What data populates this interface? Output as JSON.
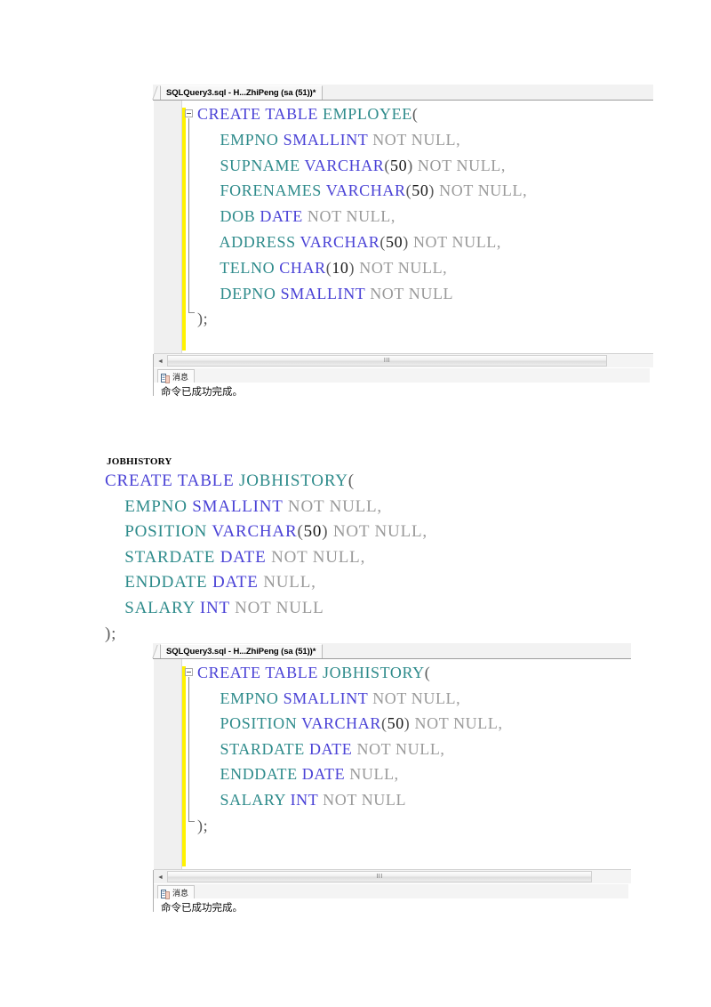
{
  "document": {
    "jobhistory_heading": "JOBHISTORY",
    "jobhistory_code_lines": [
      [
        {
          "t": "CREATE TABLE ",
          "c": "kw"
        },
        {
          "t": "JOBHISTORY",
          "c": "ident"
        },
        {
          "t": "(",
          "c": "punc"
        }
      ],
      [
        {
          "t": "    ",
          "c": "punc"
        },
        {
          "t": "EMPNO ",
          "c": "ident"
        },
        {
          "t": "SMALLINT ",
          "c": "kw"
        },
        {
          "t": "NOT NULL,",
          "c": "gray"
        }
      ],
      [
        {
          "t": "    ",
          "c": "punc"
        },
        {
          "t": "POSITION ",
          "c": "ident"
        },
        {
          "t": "VARCHAR",
          "c": "kw"
        },
        {
          "t": "(",
          "c": "punc"
        },
        {
          "t": "50",
          "c": "num"
        },
        {
          "t": ") ",
          "c": "punc"
        },
        {
          "t": "NOT NULL,",
          "c": "gray"
        }
      ],
      [
        {
          "t": "    ",
          "c": "punc"
        },
        {
          "t": "STARDATE ",
          "c": "ident"
        },
        {
          "t": "DATE ",
          "c": "kw"
        },
        {
          "t": "NOT NULL,",
          "c": "gray"
        }
      ],
      [
        {
          "t": "    ",
          "c": "punc"
        },
        {
          "t": "ENDDATE ",
          "c": "ident"
        },
        {
          "t": "DATE ",
          "c": "kw"
        },
        {
          "t": "NULL,",
          "c": "gray"
        }
      ],
      [
        {
          "t": "    ",
          "c": "punc"
        },
        {
          "t": "SALARY ",
          "c": "ident"
        },
        {
          "t": "INT ",
          "c": "kw"
        },
        {
          "t": "NOT NULL",
          "c": "gray"
        }
      ],
      [
        {
          "t": ");",
          "c": "punc"
        }
      ]
    ]
  },
  "screenshots": [
    {
      "tab_title": "SQLQuery3.sql - H...ZhiPeng (sa (51))*",
      "code_lines": [
        [
          {
            "t": "CREATE TABLE ",
            "c": "kw"
          },
          {
            "t": "EMPLOYEE",
            "c": "ident"
          },
          {
            "t": "(",
            "c": "punc"
          }
        ],
        [
          {
            "t": "     ",
            "c": "punc"
          },
          {
            "t": "EMPNO ",
            "c": "ident"
          },
          {
            "t": "SMALLINT ",
            "c": "kw"
          },
          {
            "t": "NOT NULL,",
            "c": "gray"
          }
        ],
        [
          {
            "t": "     ",
            "c": "punc"
          },
          {
            "t": "SUPNAME ",
            "c": "ident"
          },
          {
            "t": "VARCHAR",
            "c": "kw"
          },
          {
            "t": "(",
            "c": "punc"
          },
          {
            "t": "50",
            "c": "num"
          },
          {
            "t": ") ",
            "c": "punc"
          },
          {
            "t": "NOT NULL,",
            "c": "gray"
          }
        ],
        [
          {
            "t": "     ",
            "c": "punc"
          },
          {
            "t": "FORENAMES ",
            "c": "ident"
          },
          {
            "t": "VARCHAR",
            "c": "kw"
          },
          {
            "t": "(",
            "c": "punc"
          },
          {
            "t": "50",
            "c": "num"
          },
          {
            "t": ") ",
            "c": "punc"
          },
          {
            "t": "NOT NULL,",
            "c": "gray"
          }
        ],
        [
          {
            "t": "     ",
            "c": "punc"
          },
          {
            "t": "DOB ",
            "c": "ident"
          },
          {
            "t": "DATE ",
            "c": "kw"
          },
          {
            "t": "NOT NULL,",
            "c": "gray"
          }
        ],
        [
          {
            "t": "     ",
            "c": "punc"
          },
          {
            "t": "ADDRESS ",
            "c": "ident"
          },
          {
            "t": "VARCHAR",
            "c": "kw"
          },
          {
            "t": "(",
            "c": "punc"
          },
          {
            "t": "50",
            "c": "num"
          },
          {
            "t": ") ",
            "c": "punc"
          },
          {
            "t": "NOT NULL,",
            "c": "gray"
          }
        ],
        [
          {
            "t": "     ",
            "c": "punc"
          },
          {
            "t": "TELNO ",
            "c": "ident"
          },
          {
            "t": "CHAR",
            "c": "kw"
          },
          {
            "t": "(",
            "c": "punc"
          },
          {
            "t": "10",
            "c": "num"
          },
          {
            "t": ") ",
            "c": "punc"
          },
          {
            "t": "NOT NULL,",
            "c": "gray"
          }
        ],
        [
          {
            "t": "     ",
            "c": "punc"
          },
          {
            "t": "DEPNO ",
            "c": "ident"
          },
          {
            "t": "SMALLINT ",
            "c": "kw"
          },
          {
            "t": "NOT NULL",
            "c": "gray"
          }
        ],
        [
          {
            "t": ");",
            "c": "punc"
          }
        ]
      ],
      "results_tab_label": "消息",
      "results_tab_icon": "messages-grid-icon",
      "results_message": "命令已成功完成。",
      "scrollbar_grip": "III",
      "scroll_left_arrow": "◄"
    },
    {
      "tab_title": "SQLQuery3.sql - H...ZhiPeng (sa (51))*",
      "code_lines": [
        [
          {
            "t": "CREATE TABLE ",
            "c": "kw"
          },
          {
            "t": "JOBHISTORY",
            "c": "ident"
          },
          {
            "t": "(",
            "c": "punc"
          }
        ],
        [
          {
            "t": "     ",
            "c": "punc"
          },
          {
            "t": "EMPNO ",
            "c": "ident"
          },
          {
            "t": "SMALLINT ",
            "c": "kw"
          },
          {
            "t": "NOT NULL,",
            "c": "gray"
          }
        ],
        [
          {
            "t": "     ",
            "c": "punc"
          },
          {
            "t": "POSITION ",
            "c": "ident"
          },
          {
            "t": "VARCHAR",
            "c": "kw"
          },
          {
            "t": "(",
            "c": "punc"
          },
          {
            "t": "50",
            "c": "num"
          },
          {
            "t": ") ",
            "c": "punc"
          },
          {
            "t": "NOT NULL,",
            "c": "gray"
          }
        ],
        [
          {
            "t": "     ",
            "c": "punc"
          },
          {
            "t": "STARDATE ",
            "c": "ident"
          },
          {
            "t": "DATE ",
            "c": "kw"
          },
          {
            "t": "NOT NULL,",
            "c": "gray"
          }
        ],
        [
          {
            "t": "     ",
            "c": "punc"
          },
          {
            "t": "ENDDATE ",
            "c": "ident"
          },
          {
            "t": "DATE ",
            "c": "kw"
          },
          {
            "t": "NULL,",
            "c": "gray"
          }
        ],
        [
          {
            "t": "     ",
            "c": "punc"
          },
          {
            "t": "SALARY ",
            "c": "ident"
          },
          {
            "t": "INT ",
            "c": "kw"
          },
          {
            "t": "NOT NULL",
            "c": "gray"
          }
        ],
        [
          {
            "t": ");",
            "c": "punc"
          }
        ]
      ],
      "results_tab_label": "消息",
      "results_tab_icon": "messages-grid-icon",
      "results_message": "命令已成功完成。",
      "scrollbar_grip": "III",
      "scroll_left_arrow": "◄"
    }
  ],
  "colors": {
    "keyword": "#4a42d6",
    "identifier": "#2e8b8b",
    "gray_text": "#9a9a9a",
    "change_bar": "#fff200",
    "gutter": "#f0f0f0"
  }
}
